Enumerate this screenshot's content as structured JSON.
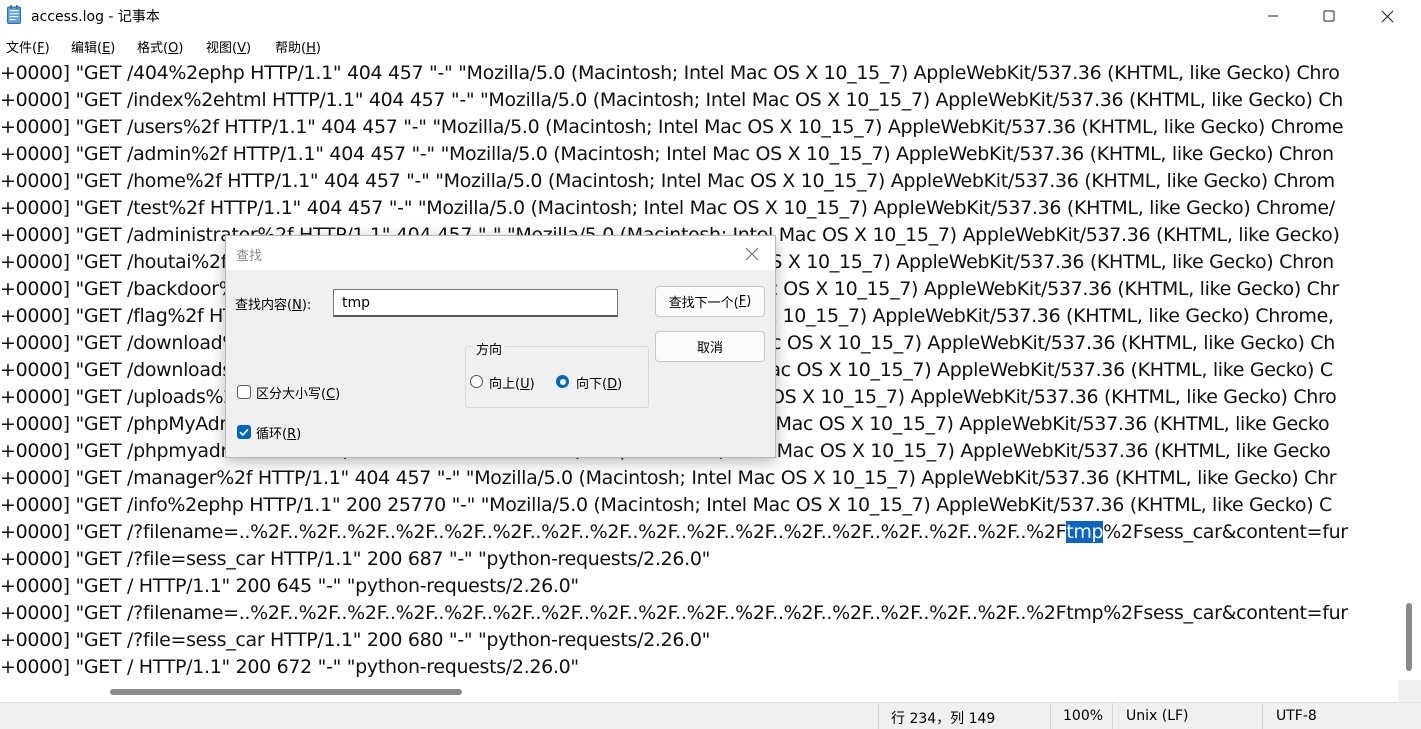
{
  "window": {
    "title": "access.log - 记事本",
    "icon": "notepad-icon",
    "minimize_icon": "minimize-icon",
    "maximize_icon": "maximize-icon",
    "close_icon": "close-icon"
  },
  "menu": [
    {
      "pre": "文件(",
      "key": "F",
      "post": ")"
    },
    {
      "pre": "编辑(",
      "key": "E",
      "post": ")"
    },
    {
      "pre": "格式(",
      "key": "O",
      "post": ")"
    },
    {
      "pre": "视图(",
      "key": "V",
      "post": ")"
    },
    {
      "pre": "帮助(",
      "key": "H",
      "post": ")"
    }
  ],
  "editor": {
    "lines": [
      "+0000] \"GET /404%2ephp HTTP/1.1\" 404 457 \"-\" \"Mozilla/5.0 (Macintosh; Intel Mac OS X 10_15_7) AppleWebKit/537.36 (KHTML, like Gecko) Chro",
      "+0000] \"GET /index%2ehtml HTTP/1.1\" 404 457 \"-\" \"Mozilla/5.0 (Macintosh; Intel Mac OS X 10_15_7) AppleWebKit/537.36 (KHTML, like Gecko) Ch",
      "+0000] \"GET /users%2f HTTP/1.1\" 404 457 \"-\" \"Mozilla/5.0 (Macintosh; Intel Mac OS X 10_15_7) AppleWebKit/537.36 (KHTML, like Gecko) Chrome",
      "+0000] \"GET /admin%2f HTTP/1.1\" 404 457 \"-\" \"Mozilla/5.0 (Macintosh; Intel Mac OS X 10_15_7) AppleWebKit/537.36 (KHTML, like Gecko) Chron",
      "+0000] \"GET /home%2f HTTP/1.1\" 404 457 \"-\" \"Mozilla/5.0 (Macintosh; Intel Mac OS X 10_15_7) AppleWebKit/537.36 (KHTML, like Gecko) Chrom",
      "+0000] \"GET /test%2f HTTP/1.1\" 404 457 \"-\" \"Mozilla/5.0 (Macintosh; Intel Mac OS X 10_15_7) AppleWebKit/537.36 (KHTML, like Gecko) Chrome/",
      "+0000] \"GET /administrator%2f HTTP/1.1\" 404 457 \"-\" \"Mozilla/5.0 (Macintosh; Intel Mac OS X 10_15_7) AppleWebKit/537.36 (KHTML, like Gecko)",
      "+0000] \"GET /houtai%2f HTTP/1.1\" 404 457 \"-\" \"Mozilla/5.0 (Macintosh; Intel Mac OS X 10_15_7) AppleWebKit/537.36 (KHTML, like Gecko) Chron",
      "+0000] \"GET /backdoor%2f HTTP/1.1\" 404 457 \"-\" \"Mozilla/5.0 (Macintosh; Intel Mac OS X 10_15_7) AppleWebKit/537.36 (KHTML, like Gecko) Chr",
      "+0000] \"GET /flag%2f HTTP/1.1\" 404 457 \"-\" \"Mozilla/5.0 (Macintosh; Intel Mac OS X 10_15_7) AppleWebKit/537.36 (KHTML, like Gecko) Chrome,",
      "+0000] \"GET /download%2f HTTP/1.1\" 404 457 \"-\" \"Mozilla/5.0 (Macintosh; Intel Mac OS X 10_15_7) AppleWebKit/537.36 (KHTML, like Gecko) Ch",
      "+0000] \"GET /downloads%2f HTTP/1.1\" 404 457 \"-\" \"Mozilla/5.0 (Macintosh; Intel Mac OS X 10_15_7) AppleWebKit/537.36 (KHTML, like Gecko) C",
      "+0000] \"GET /uploads%2f HTTP/1.1\" 404 457 \"-\" \"Mozilla/5.0 (Macintosh; Intel Mac OS X 10_15_7) AppleWebKit/537.36 (KHTML, like Gecko) Chro",
      "+0000] \"GET /phpMyAdmin%2f HTTP/1.1\" 404 457 \"-\" \"Mozilla/5.0 (Macintosh; Intel Mac OS X 10_15_7) AppleWebKit/537.36 (KHTML, like Gecko",
      "+0000] \"GET /phpmyadmin%2f HTTP/1.1\" 404 457 \"-\" \"Mozilla/5.0 (Macintosh; Intel Mac OS X 10_15_7) AppleWebKit/537.36 (KHTML, like Gecko",
      "+0000] \"GET /manager%2f HTTP/1.1\" 404 457 \"-\" \"Mozilla/5.0 (Macintosh; Intel Mac OS X 10_15_7) AppleWebKit/537.36 (KHTML, like Gecko) Chr",
      "+0000] \"GET /info%2ephp HTTP/1.1\" 200 25770 \"-\" \"Mozilla/5.0 (Macintosh; Intel Mac OS X 10_15_7) AppleWebKit/537.36 (KHTML, like Gecko) C",
      "+0000] \"GET /?filename=..%2F..%2F..%2F..%2F..%2F..%2F..%2F..%2F..%2F..%2F..%2F..%2F..%2F..%2F..%2F..%2F..%2Ftmp%2Fsess_car&content=fur",
      "+0000] \"GET /?file=sess_car HTTP/1.1\" 200 687 \"-\" \"python-requests/2.26.0\"",
      "+0000] \"GET / HTTP/1.1\" 200 645 \"-\" \"python-requests/2.26.0\"",
      "+0000] \"GET /?filename=..%2F..%2F..%2F..%2F..%2F..%2F..%2F..%2F..%2F..%2F..%2F..%2F..%2F..%2F..%2F..%2F..%2Ftmp%2Fsess_car&content=fur",
      "+0000] \"GET /?file=sess_car HTTP/1.1\" 200 680 \"-\" \"python-requests/2.26.0\"",
      "+0000] \"GET / HTTP/1.1\" 200 672 \"-\" \"python-requests/2.26.0\""
    ],
    "selected_text": "tmp",
    "selected_line": 17,
    "selection_color": "#0a64c8"
  },
  "statusbar": {
    "position": "行 234，列 149",
    "zoom": "100%",
    "line_ending": "Unix (LF)",
    "encoding": "UTF-8"
  },
  "find_dialog": {
    "title": "查找",
    "close_icon": "close-icon",
    "find_label_pre": "查找内容(",
    "find_label_key": "N",
    "find_label_post": "):",
    "find_value": "tmp",
    "find_next_pre": "查找下一个(",
    "find_next_key": "F",
    "find_next_post": ")",
    "cancel": "取消",
    "direction_label": "方向",
    "up_pre": "向上(",
    "up_key": "U",
    "up_post": ")",
    "down_pre": "向下(",
    "down_key": "D",
    "down_post": ")",
    "direction_selected": "down",
    "match_case_pre": "区分大小写(",
    "match_case_key": "C",
    "match_case_post": ")",
    "match_case_checked": false,
    "wrap_pre": "循环(",
    "wrap_key": "R",
    "wrap_post": ")",
    "wrap_checked": true,
    "accent_color": "#0067c0"
  }
}
